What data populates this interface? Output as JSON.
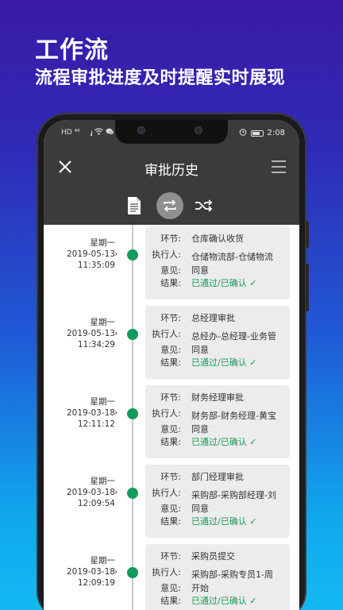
{
  "promo": {
    "title": "工作流",
    "subtitle": "流程审批进度及时提醒实时展现"
  },
  "statusbar": {
    "left": "HD ⁴⁶",
    "time": "2:08"
  },
  "navbar": {
    "title": "审批历史"
  },
  "labels": {
    "step": "环节:",
    "executor": "执行人:",
    "opinion": "意见:",
    "result": "结果:"
  },
  "entries": [
    {
      "weekday": "星期一",
      "date": "2019-05-13",
      "time": "11:35:09",
      "step": "仓库确认收货",
      "executor": "仓储物流部-仓储物流",
      "opinion": "同意",
      "result": "已通过/已确认 ✓"
    },
    {
      "weekday": "星期一",
      "date": "2019-05-13",
      "time": "11:34:29",
      "step": "总经理审批",
      "executor": "总经办-总经理-业务管",
      "opinion": "同意",
      "result": "已通过/已确认 ✓"
    },
    {
      "weekday": "星期一",
      "date": "2019-03-18",
      "time": "12:11:12",
      "step": "财务经理审批",
      "executor": "财务部-财务经理-黄宝",
      "opinion": "同意",
      "result": "已通过/已确认 ✓"
    },
    {
      "weekday": "星期一",
      "date": "2019-03-18",
      "time": "12:09:54",
      "step": "部门经理审批",
      "executor": "采购部-采购部经理-刘",
      "opinion": "同意",
      "result": "已通过/已确认 ✓"
    },
    {
      "weekday": "星期一",
      "date": "2019-03-18",
      "time": "12:09:19",
      "step": "采购员提交",
      "executor": "采购部-采购专员1-周",
      "opinion": "开始",
      "result": "已通过/已确认 ✓"
    }
  ],
  "colors": {
    "accent_green": "#159a5d",
    "header_gray": "#3b3b3b"
  }
}
